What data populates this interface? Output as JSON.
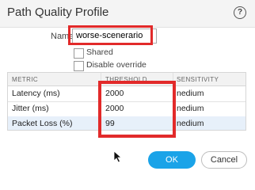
{
  "dialog": {
    "title": "Path Quality Profile",
    "help_icon": "help-icon",
    "help_glyph": "?"
  },
  "form": {
    "name_label": "Name",
    "name_value": "worse-scenerario",
    "shared_label": "Shared",
    "shared_checked": false,
    "disable_override_label": "Disable override",
    "disable_override_checked": false
  },
  "table": {
    "columns": [
      "METRIC",
      "THRESHOLD",
      "SENSITIVITY"
    ],
    "rows": [
      {
        "metric": "Latency (ms)",
        "threshold": "2000",
        "sensitivity": "nedium"
      },
      {
        "metric": "Jitter (ms)",
        "threshold": "2000",
        "sensitivity": "nedium"
      },
      {
        "metric": "Packet Loss (%)",
        "threshold": "99",
        "sensitivity": "nedium"
      }
    ]
  },
  "buttons": {
    "ok_label": "OK",
    "cancel_label": "Cancel"
  },
  "colors": {
    "accent": "#1aa3e8",
    "highlight": "#e22a2a",
    "selected_row": "#e7f0fa"
  }
}
